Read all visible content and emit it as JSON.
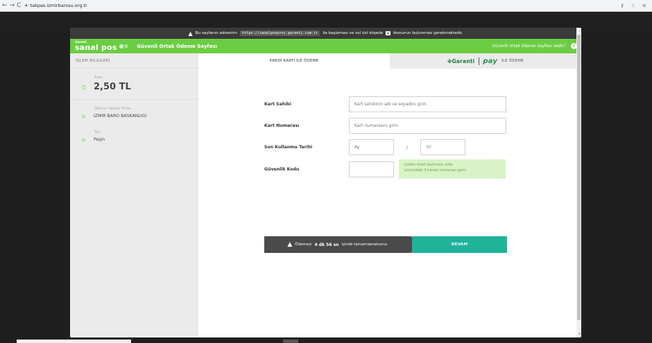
{
  "browser": {
    "url": "takpas.izmirbarosu.org.tr"
  },
  "notice": {
    "prefix": "Bu sayfanın adresinin",
    "address": "https://sanalposprov.garanti.com.tr",
    "middle": "ile başlaması ve sol üst köşede",
    "suffix": "ikonunun bulunması gerekmektedir."
  },
  "header": {
    "brand_small": "Garanti",
    "brand_large": "sanal pos",
    "title": "Güvenli Ortak Ödeme Sayfası",
    "help_link": "Güvenli ortak ödeme sayfası nedir?",
    "help_icon_glyph": "?"
  },
  "sidebar": {
    "heading": "İŞLEM BİLGİLERİ",
    "amount_label": "Tutar",
    "amount_value": "2,50 TL",
    "company_label": "Ödeme Yapılan Firma",
    "company_value": "IZMIR BARO BASKANLIGI",
    "type_label": "Tipi",
    "type_value": "Peşin"
  },
  "tabs": {
    "card_tab": "KREDİ KARTI İLE ÖDEME",
    "garanti": "Garanti",
    "pay": "pay",
    "pay_suffix": "İLE ÖDEME"
  },
  "form": {
    "holder_label": "Kart Sahibi",
    "holder_placeholder": "Kart sahibinin adı ve soyadını girin",
    "number_label": "Kart Numarası",
    "number_placeholder": "Kart numarasını girin",
    "expiry_label": "Son Kullanma Tarihi",
    "month_placeholder": "Ay",
    "separator": "/",
    "year_placeholder": "Yıl",
    "cvv_label": "Güvenlik Kodu",
    "cvv_hint_line1": "Lütfen kredi kartınızın arka",
    "cvv_hint_line2": "yüzündeki 3 haneli numarayı girin."
  },
  "timer": {
    "prefix": "Ödemeyi",
    "time": "4 dk 56 sn",
    "suffix": "içinde tamamlamalısınız."
  },
  "submit_label": "DEVAM",
  "colors": {
    "brand_green": "#6bcd43",
    "submit_teal": "#1fb39a",
    "notice_bg": "#3a3a3a"
  }
}
